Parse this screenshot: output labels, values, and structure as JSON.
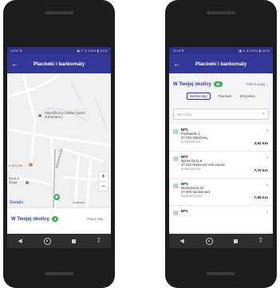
{
  "colors": {
    "primary": "#34379a",
    "status": "#2f3188",
    "accent": "#3daf57"
  },
  "left_phone": {
    "statusbar": {
      "left": "15:00 ⚙",
      "right": "▣ ✈ ◎ 100% ▮ 15:00"
    },
    "appbar": {
      "title": "Placówki i bankomaty",
      "back_icon": "arrow-left-icon"
    },
    "map": {
      "poi_1": "Niepubliczny Zakład Opieki Zdrowotnej...",
      "poi_2": "a Bazylia",
      "poi_3": "Dawno\nolega",
      "street_1": "Miedzychodzka",
      "street_2": "Szyfrowa",
      "zoom_in": "+",
      "zoom_out": "−",
      "attribution": "Google"
    },
    "sheet": {
      "title": "W Twojej okolicy",
      "count": "3",
      "link": "Pokaż listę ⌃"
    },
    "navbar": {
      "back": "◀",
      "menu": "⁑"
    }
  },
  "right_phone": {
    "statusbar": {
      "left": "15:00 ⚙",
      "right": "▣ ✈ ◎ 100% ▮ 15:00"
    },
    "appbar": {
      "title": "Placówki i bankomaty",
      "back_icon": "arrow-left-icon"
    },
    "header": {
      "title": "W Twojej okolicy",
      "count": "38",
      "link": "Pokaż mapę ⌄"
    },
    "tabs": [
      "Bankomaty",
      "Placówki",
      "Wszystkie"
    ],
    "search": {
      "placeholder": "Wyszukaj"
    },
    "items": [
      {
        "name": "BPS",
        "street": "Podstaszki 1",
        "city": "37-415 Zaleszany",
        "region": "podkarpackie",
        "distance": "3,62 km"
      },
      {
        "name": "BPS",
        "street": "Rynek Duży 9",
        "city": "37-432 Radomyśl nad Sanem",
        "region": "podkarpackie",
        "distance": "7,70 km"
      },
      {
        "name": "BPS",
        "street": "Mickiewicza 34",
        "city": "27-600 Sandomierz",
        "region": "świętokrzyskie",
        "distance": "7,89 km"
      },
      {
        "name": "BPS",
        "street": "",
        "city": "",
        "region": "",
        "distance": ""
      }
    ],
    "navbar": {
      "back": "◀",
      "menu": "⁑"
    }
  }
}
